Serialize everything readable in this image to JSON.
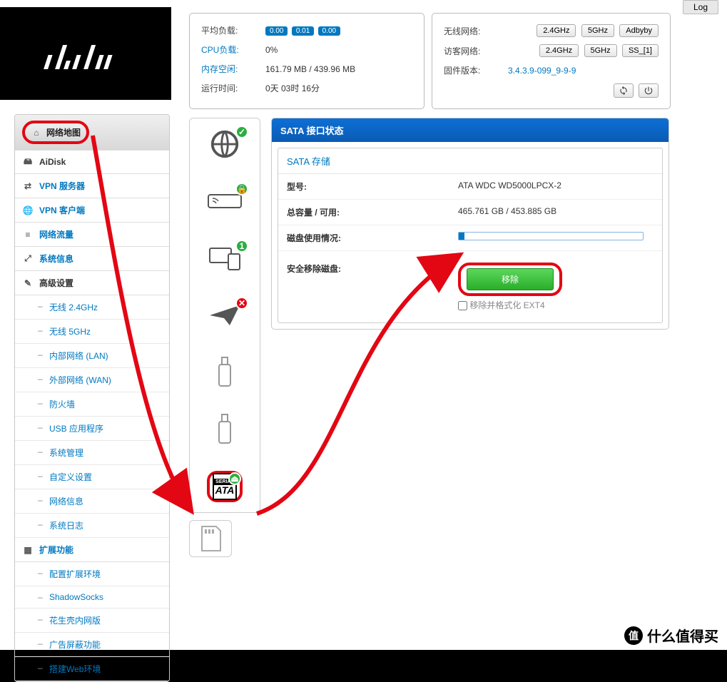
{
  "log_btn": "Log",
  "status_left": {
    "avg_label": "平均负载:",
    "avg_badges": [
      "0.00",
      "0.01",
      "0.00"
    ],
    "cpu_label": "CPU负载:",
    "cpu_val": "0%",
    "mem_label": "内存空闲:",
    "mem_val": "161.79 MB / 439.96 MB",
    "uptime_label": "运行时间:",
    "uptime_val": "0天 03时 16分"
  },
  "status_right": {
    "wifi_label": "无线网络:",
    "guest_label": "访客网络:",
    "fw_label": "固件版本:",
    "fw_val": "3.4.3.9-099_9-9-9",
    "btn_24": "2.4GHz",
    "btn_5": "5GHz",
    "btn_adbyby": "Adbyby",
    "btn_ss": "SS_[1]",
    "refresh": "↻",
    "power": "⏻"
  },
  "sidebar": {
    "items": [
      {
        "label": "网络地图",
        "icon": "⌂",
        "top": true
      },
      {
        "label": "AiDisk",
        "icon": "🖴",
        "bold": true
      },
      {
        "label": "VPN 服务器",
        "icon": "⇄",
        "blue": true
      },
      {
        "label": "VPN 客户端",
        "icon": "🌐",
        "blue": true
      },
      {
        "label": "网络流量",
        "icon": "≡",
        "blue": true
      },
      {
        "label": "系统信息",
        "icon": "⤢",
        "blue": true
      },
      {
        "label": "高级设置",
        "icon": "✎",
        "bold": true
      }
    ],
    "adv": [
      "无线 2.4GHz",
      "无线 5GHz",
      "内部网络 (LAN)",
      "外部网络 (WAN)",
      "防火墙",
      "USB 应用程序",
      "系统管理",
      "自定义设置",
      "网络信息",
      "系统日志"
    ],
    "ext_label": "扩展功能",
    "ext": [
      "配置扩展环境",
      "ShadowSocks",
      "花生壳内网版",
      "广告屏蔽功能",
      "搭建Web环境"
    ]
  },
  "iconcol": {
    "sata_top": "SERIAL",
    "sata_bot": "ATA"
  },
  "main": {
    "title": "SATA 接口状态",
    "sec_title": "SATA 存储",
    "model_label": "型号:",
    "model_val": "ATA WDC WD5000LPCX-2",
    "cap_label": "总容量 / 可用:",
    "cap_val": "465.761 GB / 453.885 GB",
    "usage_label": "磁盘使用情况:",
    "remove_label": "安全移除磁盘:",
    "remove_btn": "移除",
    "format_chk": "移除并格式化 EXT4"
  },
  "watermark": {
    "circ": "值",
    "text": "什么值得买"
  }
}
